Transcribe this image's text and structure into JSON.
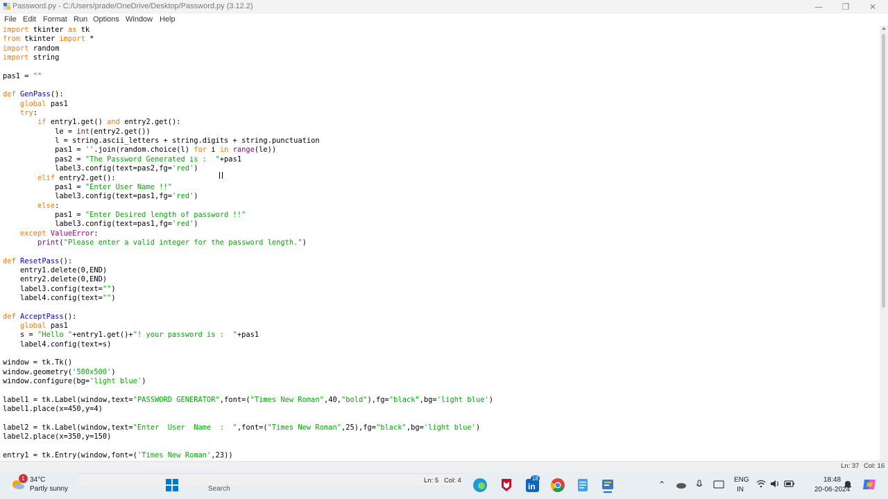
{
  "window": {
    "title": "Password.py - C:/Users/prade/OneDrive/Desktop/Password.py (3.12.2)",
    "minimize_glyph": "—",
    "maximize_glyph": "❐",
    "close_glyph": "✕"
  },
  "menu": [
    "File",
    "Edit",
    "Format",
    "Run",
    "Options",
    "Window",
    "Help"
  ],
  "code_lines": [
    [
      {
        "t": "import",
        "c": "kw"
      },
      {
        "t": " tkinter "
      },
      {
        "t": "as",
        "c": "kw"
      },
      {
        "t": " tk"
      }
    ],
    [
      {
        "t": "from",
        "c": "kw"
      },
      {
        "t": " tkinter "
      },
      {
        "t": "import",
        "c": "kw"
      },
      {
        "t": " *"
      }
    ],
    [
      {
        "t": "import",
        "c": "kw"
      },
      {
        "t": " random"
      }
    ],
    [
      {
        "t": "import",
        "c": "kw"
      },
      {
        "t": " string"
      }
    ],
    [],
    [
      {
        "t": "pas1 = "
      },
      {
        "t": "\"\"",
        "c": "st"
      }
    ],
    [],
    [
      {
        "t": "def",
        "c": "kw"
      },
      {
        "t": " "
      },
      {
        "t": "GenPass",
        "c": "df"
      },
      {
        "t": "():"
      }
    ],
    [
      {
        "t": "    "
      },
      {
        "t": "global",
        "c": "kw"
      },
      {
        "t": " pas1"
      }
    ],
    [
      {
        "t": "    "
      },
      {
        "t": "try",
        "c": "kw"
      },
      {
        "t": ":"
      }
    ],
    [
      {
        "t": "        "
      },
      {
        "t": "if",
        "c": "kw"
      },
      {
        "t": " entry1.get() "
      },
      {
        "t": "and",
        "c": "kw"
      },
      {
        "t": " entry2.get():"
      }
    ],
    [
      {
        "t": "            le = "
      },
      {
        "t": "int",
        "c": "bi"
      },
      {
        "t": "(entry2.get())"
      }
    ],
    [
      {
        "t": "            l = string.ascii_letters + string.digits + string.punctuation"
      }
    ],
    [
      {
        "t": "            pas1 = "
      },
      {
        "t": "''",
        "c": "st"
      },
      {
        "t": ".join(random.choice(l) "
      },
      {
        "t": "for",
        "c": "kw"
      },
      {
        "t": " i "
      },
      {
        "t": "in",
        "c": "kw"
      },
      {
        "t": " "
      },
      {
        "t": "range",
        "c": "bi"
      },
      {
        "t": "(le))"
      }
    ],
    [
      {
        "t": "            pas2 = "
      },
      {
        "t": "\"The Password Generated is :  \"",
        "c": "st"
      },
      {
        "t": "+pas1"
      }
    ],
    [
      {
        "t": "            label3.config(text=pas2,fg="
      },
      {
        "t": "'red'",
        "c": "st"
      },
      {
        "t": ")"
      }
    ],
    [
      {
        "t": "        "
      },
      {
        "t": "elif",
        "c": "kw"
      },
      {
        "t": " entry2.get():"
      }
    ],
    [
      {
        "t": "            pas1 = "
      },
      {
        "t": "\"Enter User Name !!\"",
        "c": "st"
      }
    ],
    [
      {
        "t": "            label3.config(text=pas1,fg="
      },
      {
        "t": "'red'",
        "c": "st"
      },
      {
        "t": ")"
      }
    ],
    [
      {
        "t": "        "
      },
      {
        "t": "else",
        "c": "kw"
      },
      {
        "t": ":"
      }
    ],
    [
      {
        "t": "            pas1 = "
      },
      {
        "t": "\"Enter Desired length of password !!\"",
        "c": "st"
      }
    ],
    [
      {
        "t": "            label3.config(text=pas1,fg="
      },
      {
        "t": "'red'",
        "c": "st"
      },
      {
        "t": ")"
      }
    ],
    [
      {
        "t": "    "
      },
      {
        "t": "except",
        "c": "kw"
      },
      {
        "t": " "
      },
      {
        "t": "ValueError",
        "c": "bi"
      },
      {
        "t": ":"
      }
    ],
    [
      {
        "t": "        "
      },
      {
        "t": "print",
        "c": "bi"
      },
      {
        "t": "("
      },
      {
        "t": "\"Please enter a valid integer for the password length.\"",
        "c": "st"
      },
      {
        "t": ")"
      }
    ],
    [],
    [
      {
        "t": "def",
        "c": "kw"
      },
      {
        "t": " "
      },
      {
        "t": "ResetPass",
        "c": "df"
      },
      {
        "t": "():"
      }
    ],
    [
      {
        "t": "    entry1.delete(0,END)"
      }
    ],
    [
      {
        "t": "    entry2.delete(0,END)"
      }
    ],
    [
      {
        "t": "    label3.config(text="
      },
      {
        "t": "\"\"",
        "c": "st"
      },
      {
        "t": ")"
      }
    ],
    [
      {
        "t": "    label4.config(text="
      },
      {
        "t": "\"\"",
        "c": "st"
      },
      {
        "t": ")"
      }
    ],
    [],
    [
      {
        "t": "def",
        "c": "kw"
      },
      {
        "t": " "
      },
      {
        "t": "AcceptPass",
        "c": "df"
      },
      {
        "t": "():"
      }
    ],
    [
      {
        "t": "    "
      },
      {
        "t": "global",
        "c": "kw"
      },
      {
        "t": " pas1"
      }
    ],
    [
      {
        "t": "    s = "
      },
      {
        "t": "\"Hello \"",
        "c": "st"
      },
      {
        "t": "+entry1.get()+"
      },
      {
        "t": "\"! your password is :  \"",
        "c": "st"
      },
      {
        "t": "+pas1"
      }
    ],
    [
      {
        "t": "    label4.config(text=s)"
      }
    ],
    [],
    [
      {
        "t": "window = tk.Tk()"
      }
    ],
    [
      {
        "t": "window.geometry("
      },
      {
        "t": "'500x500'",
        "c": "st"
      },
      {
        "t": ")"
      }
    ],
    [
      {
        "t": "window.configure(bg="
      },
      {
        "t": "'light blue'",
        "c": "st"
      },
      {
        "t": ")"
      }
    ],
    [],
    [
      {
        "t": "label1 = tk.Label(window,text="
      },
      {
        "t": "\"PASSWORD GENERATOR\"",
        "c": "st"
      },
      {
        "t": ",font=("
      },
      {
        "t": "\"Times New Roman\"",
        "c": "st"
      },
      {
        "t": ",40,"
      },
      {
        "t": "\"bold\"",
        "c": "st"
      },
      {
        "t": "),fg="
      },
      {
        "t": "\"black\"",
        "c": "st"
      },
      {
        "t": ",bg="
      },
      {
        "t": "'light blue'",
        "c": "st"
      },
      {
        "t": ")"
      }
    ],
    [
      {
        "t": "label1.place(x=450,y=4)"
      }
    ],
    [],
    [
      {
        "t": "label2 = tk.Label(window,text="
      },
      {
        "t": "\"Enter  User  Name  :  \"",
        "c": "st"
      },
      {
        "t": ",font=("
      },
      {
        "t": "\"Times New Roman\"",
        "c": "st"
      },
      {
        "t": ",25),fg="
      },
      {
        "t": "\"black\"",
        "c": "st"
      },
      {
        "t": ",bg="
      },
      {
        "t": "'light blue'",
        "c": "st"
      },
      {
        "t": ")"
      }
    ],
    [
      {
        "t": "label2.place(x=350,y=150)"
      }
    ],
    [],
    [
      {
        "t": "entry1 = tk.Entry(window,font=("
      },
      {
        "t": "'Times New Roman'",
        "c": "st"
      },
      {
        "t": ",23))"
      }
    ]
  ],
  "status": {
    "ln": "Ln: 37",
    "col": "Col: 16"
  },
  "overlay_status": {
    "ln": "Ln: 5",
    "col": "Col: 4"
  },
  "search_peek": "Search",
  "weather": {
    "badge": "1",
    "temp": "34°C",
    "desc": "Partly sunny"
  },
  "taskbar_badge": "18",
  "tray": {
    "lang1": "ENG",
    "lang2": "IN",
    "time": "18:48",
    "date": "20-06-2024"
  },
  "colors": {
    "keyword": "#ff7700",
    "builtin": "#900090",
    "string": "#00aa00",
    "definition": "#0000ff"
  }
}
